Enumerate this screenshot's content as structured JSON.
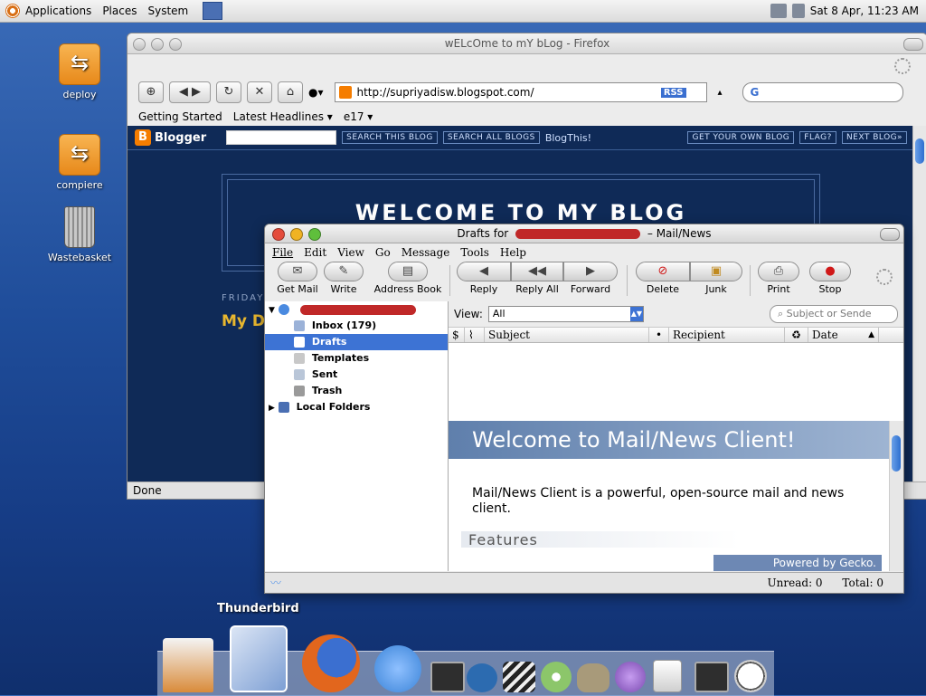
{
  "top_panel": {
    "menus": [
      "Applications",
      "Places",
      "System"
    ],
    "clock": "Sat  8 Apr, 11:23 AM"
  },
  "desktop": {
    "icons": [
      {
        "label": "deploy",
        "icon": "drive-icon"
      },
      {
        "label": "compiere",
        "icon": "drive-icon"
      },
      {
        "label": "Wastebasket",
        "icon": "wastebasket-icon"
      }
    ]
  },
  "firefox": {
    "title": "wELcOme to mY bLog - Firefox",
    "url": "http://supriyadisw.blogspot.com/",
    "search_value": "",
    "rss_label": "RSS",
    "bookmarks": [
      "Getting Started",
      "Latest Headlines ▾",
      "e17 ▾"
    ],
    "status": "Done",
    "blogger_bar": {
      "logo": "Blogger",
      "buttons": [
        "SEARCH THIS BLOG",
        "SEARCH ALL BLOGS",
        "BlogThis!",
        "GET YOUR OWN BLOG",
        "FLAG?",
        "NEXT BLOG»"
      ]
    },
    "blog": {
      "title": "WELCOME TO MY BLOG",
      "date_fragment": "FRIDAY,",
      "post_fragment": "My Da"
    }
  },
  "thunderbird": {
    "title_prefix": "Drafts for",
    "title_suffix": "– Mail/News",
    "menus": [
      "File",
      "Edit",
      "View",
      "Go",
      "Message",
      "Tools",
      "Help"
    ],
    "toolbar": [
      {
        "label": "Get Mail",
        "icon": "get-mail-icon",
        "glyph": "✉"
      },
      {
        "label": "Write",
        "icon": "write-icon",
        "glyph": "✎"
      },
      {
        "label": "Address Book",
        "icon": "address-book-icon",
        "glyph": "▤"
      },
      {
        "label": "Reply",
        "icon": "reply-icon",
        "glyph": "◀"
      },
      {
        "label": "Reply All",
        "icon": "reply-all-icon",
        "glyph": "◀◀"
      },
      {
        "label": "Forward",
        "icon": "forward-icon",
        "glyph": "▶"
      },
      {
        "label": "Delete",
        "icon": "delete-icon",
        "glyph": "⊘"
      },
      {
        "label": "Junk",
        "icon": "junk-icon",
        "glyph": "▣"
      },
      {
        "label": "Print",
        "icon": "print-icon",
        "glyph": "⎙"
      },
      {
        "label": "Stop",
        "icon": "stop-icon",
        "glyph": "●"
      }
    ],
    "folders": [
      {
        "label": "Inbox (179)",
        "icon": "inbox-icon"
      },
      {
        "label": "Drafts",
        "icon": "drafts-icon",
        "selected": true
      },
      {
        "label": "Templates",
        "icon": "templates-icon"
      },
      {
        "label": "Sent",
        "icon": "sent-icon"
      },
      {
        "label": "Trash",
        "icon": "trash-icon"
      },
      {
        "label": "Local Folders",
        "icon": "local-folders-icon"
      }
    ],
    "view_label": "View:",
    "view_value": "All",
    "search_placeholder": "Subject or Sende",
    "columns": {
      "subject": "Subject",
      "recipient": "Recipient",
      "date": "Date"
    },
    "preview": {
      "heading": "Welcome to Mail/News Client!",
      "body": "Mail/News Client is a powerful, open-source mail and news client.",
      "features": "Features",
      "powered": "Powered by Gecko."
    },
    "status": {
      "unread": "Unread: 0",
      "total": "Total: 0"
    }
  },
  "dock": {
    "label": "Thunderbird",
    "items": [
      {
        "name": "home-icon",
        "color": "#d98b3a"
      },
      {
        "name": "thunderbird-icon",
        "color": "#7d9fd4"
      },
      {
        "name": "firefox-icon",
        "color": "#e2661d"
      },
      {
        "name": "ichat-icon",
        "color": "#3b84d8"
      },
      {
        "name": "terminal-icon",
        "color": "#3a3a3a"
      },
      {
        "name": "fish-icon",
        "color": "#2c6bb0"
      },
      {
        "name": "clapperboard-icon",
        "color": "#3a5db0"
      },
      {
        "name": "itunes-icon",
        "color": "#8cc66a"
      },
      {
        "name": "gimp-icon",
        "color": "#a89a7a"
      },
      {
        "name": "music-icon",
        "color": "#7a4ab0"
      },
      {
        "name": "ipod-icon",
        "color": "#dcdcdc"
      },
      {
        "name": "terminal2-icon",
        "color": "#3a3a3a"
      },
      {
        "name": "clock-icon",
        "color": "#cfcfcf"
      }
    ]
  }
}
